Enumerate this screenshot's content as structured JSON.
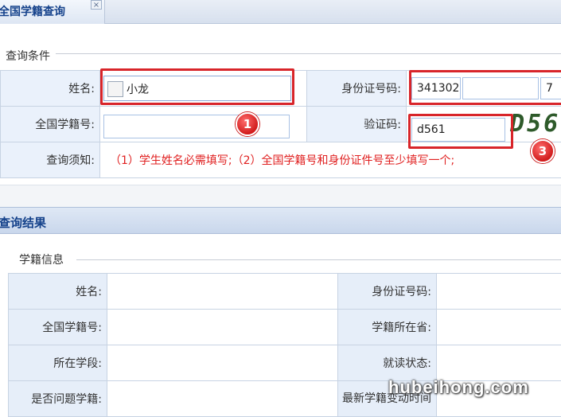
{
  "tab": {
    "title": "全国学籍查询",
    "close_glyph": "×"
  },
  "query_section": {
    "legend": "查询条件",
    "name_label": "姓名:",
    "name_value": "小龙",
    "id_label": "身份证号码:",
    "id_part1": "341302",
    "id_part2": "",
    "id_part3": "7",
    "student_no_label": "全国学籍号:",
    "student_no_value": "",
    "captcha_label": "验证码:",
    "captcha_value": "d561",
    "captcha_image_text": "D56",
    "notice_label": "查询须知:",
    "notice_text": "（1）学生姓名必需填写;（2）全国学籍号和身份证件号至少填写一个;"
  },
  "badges": {
    "one": "1",
    "three": "3"
  },
  "results_section": {
    "title": "查询结果",
    "legend": "学籍信息",
    "rows": [
      {
        "left_label": "姓名:",
        "right_label": "身份证号码:"
      },
      {
        "left_label": "全国学籍号:",
        "right_label": "学籍所在省:"
      },
      {
        "left_label": "所在学段:",
        "right_label": "就读状态:"
      },
      {
        "left_label": "是否问题学籍:",
        "right_label": "最新学籍变动时间"
      }
    ]
  },
  "watermark": "hubeihong.com",
  "colors": {
    "highlight_red": "#d8252a",
    "notice_red": "#e02020",
    "header_blue": "#15428b"
  }
}
